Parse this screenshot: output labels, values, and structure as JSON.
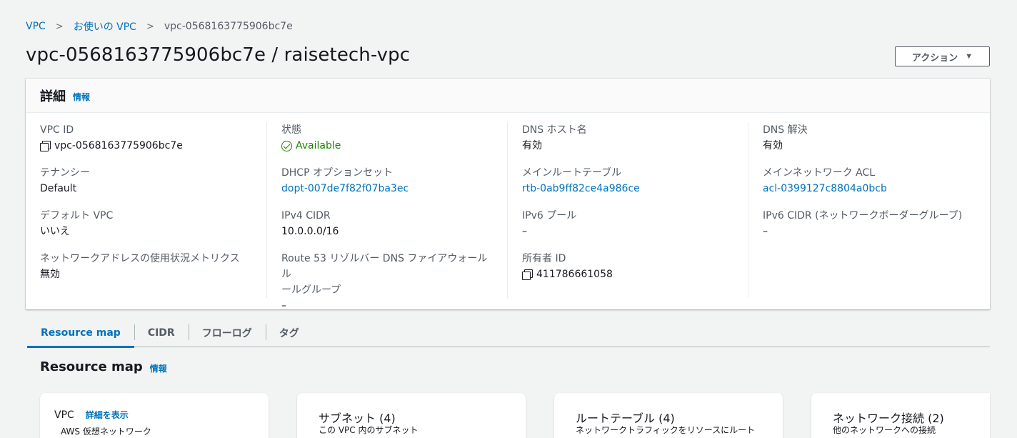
{
  "breadcrumb": [
    "VPC",
    "お使いの VPC",
    "vpc-0568163775906bc7e"
  ],
  "page_title": "vpc-0568163775906bc7e / raisetech-vpc",
  "actions_label": "アクション",
  "details": {
    "title": "詳細",
    "info": "情報",
    "columns": [
      [
        {
          "label": "VPC ID",
          "value": "vpc-0568163775906bc7e"
        },
        {
          "label": "テナンシー",
          "value": "Default"
        },
        {
          "label": "デフォルト VPC",
          "value": "いいえ"
        },
        {
          "label": "ネットワークアドレスの使用状況メトリクス",
          "value": "無効"
        }
      ],
      [
        {
          "label": "状態",
          "value": "Available"
        },
        {
          "label": "DHCP オプションセット",
          "value": "dopt-007de7f82f07ba3ec"
        },
        {
          "label": "IPv4 CIDR",
          "value": "10.0.0.0/16"
        },
        {
          "label_line1": "Route 53 リゾルバー DNS ファイアウォールル",
          "label_line2": "ールグループ",
          "value": "–"
        }
      ],
      [
        {
          "label": "DNS ホスト名",
          "value": "有効"
        },
        {
          "label": "メインルートテーブル",
          "value": "rtb-0ab9ff82ce4a986ce"
        },
        {
          "label": "IPv6 プール",
          "value": "–"
        },
        {
          "label": "所有者 ID",
          "value": "411786661058"
        }
      ],
      [
        {
          "label": "DNS 解決",
          "value": "有効"
        },
        {
          "label": "メインネットワーク ACL",
          "value": "acl-0399127c8804a0bcb"
        },
        {
          "label": "IPv6 CIDR (ネットワークボーダーグループ)",
          "value": "–"
        }
      ]
    ]
  },
  "tabs": [
    "Resource map",
    "CIDR",
    "フローログ",
    "タグ"
  ],
  "resource_map": {
    "title": "Resource map",
    "info": "情報",
    "cards": [
      {
        "title": "VPC",
        "link": "詳細を表示",
        "subtitle": "AWS 仮想ネットワーク"
      },
      {
        "title": "サブネット (4)",
        "subtitle": "この VPC 内のサブネット"
      },
      {
        "title": "ルートテーブル (4)",
        "subtitle": "ネットワークトラフィックをリソースにルート"
      },
      {
        "title": "ネットワーク接続 (2)",
        "subtitle": "他のネットワークへの接続"
      }
    ]
  }
}
